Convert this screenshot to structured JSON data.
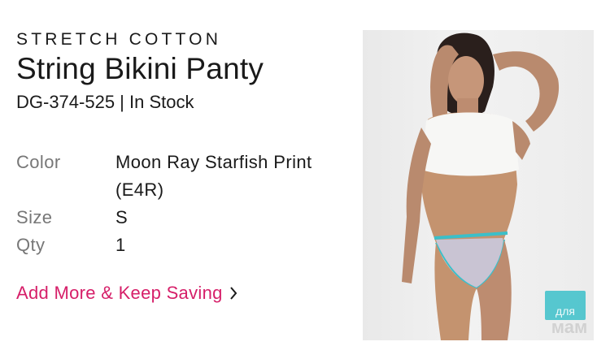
{
  "product": {
    "eyebrow": "STRETCH COTTON",
    "title": "String Bikini Panty",
    "sku_line": "DG-374-525 | In Stock"
  },
  "details": [
    {
      "label": "Color",
      "value": "Moon Ray Starfish Print (E4R)"
    },
    {
      "label": "Size",
      "value": "S"
    },
    {
      "label": "Qty",
      "value": "1"
    }
  ],
  "cta": {
    "label": "Add More & Keep Saving",
    "color": "#d61f69"
  },
  "image": {
    "subject": "model-photo",
    "top_color": "#ffffff",
    "bottom_color": "#c9c4d3",
    "trim_color": "#3bbfc9"
  },
  "watermark": {
    "text_top": "для",
    "text_bottom": "мам",
    "accent": "#3bbfc9"
  }
}
